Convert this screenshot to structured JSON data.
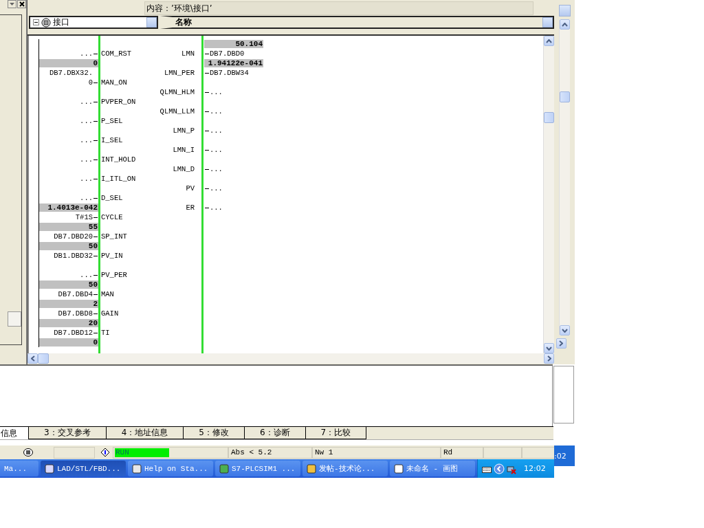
{
  "header": {
    "content_label": "内容：’环境\\接口’",
    "tree_node": "接口",
    "column_header": "名称"
  },
  "block": {
    "inputs": [
      {
        "name": "COM_RST",
        "address": "..."
      },
      {
        "name": "MAN_ON",
        "value": "0",
        "address_lines": [
          "DB7.DBX32."
        ],
        "address": "0"
      },
      {
        "name": "PVPER_ON",
        "address": "..."
      },
      {
        "name": "P_SEL",
        "address": "..."
      },
      {
        "name": "I_SEL",
        "address": "..."
      },
      {
        "name": "INT_HOLD",
        "address": "..."
      },
      {
        "name": "I_ITL_ON",
        "address": "..."
      },
      {
        "name": "D_SEL",
        "address": "..."
      },
      {
        "name": "CYCLE",
        "value": "1.4013e-042",
        "address": "T#1S"
      },
      {
        "name": "SP_INT",
        "value": "55",
        "address": "DB7.DBD20"
      },
      {
        "name": "PV_IN",
        "value": "50",
        "address": "DB1.DBD32"
      },
      {
        "name": "PV_PER",
        "address": "..."
      },
      {
        "name": "MAN",
        "value": "50",
        "address": "DB7.DBD4"
      },
      {
        "name": "GAIN",
        "value": "2",
        "address": "DB7.DBD8"
      },
      {
        "name": "TI",
        "value": "20",
        "address": "DB7.DBD12"
      },
      {
        "value": "0"
      }
    ],
    "outputs": [
      {
        "name": "LMN",
        "value": "50.104",
        "address": "DB7.DBD0"
      },
      {
        "name": "LMN_PER",
        "value": "1.94122e-041",
        "address": "DB7.DBW34"
      },
      {
        "name": "QLMN_HLM",
        "address": "..."
      },
      {
        "name": "QLMN_LLM",
        "address": "..."
      },
      {
        "name": "LMN_P",
        "address": "..."
      },
      {
        "name": "LMN_I",
        "address": "..."
      },
      {
        "name": "LMN_D",
        "address": "..."
      },
      {
        "name": "PV",
        "address": "..."
      },
      {
        "name": "ER",
        "address": "..."
      }
    ]
  },
  "tabs": [
    {
      "label": "信息",
      "selected": true
    },
    {
      "label": "3：交叉参考",
      "selected": false
    },
    {
      "label": "4：地址信息",
      "selected": false
    },
    {
      "label": "5：修改",
      "selected": false
    },
    {
      "label": "6：诊断",
      "selected": false
    },
    {
      "label": "7：比较",
      "selected": false
    }
  ],
  "status_bar": {
    "mode": "RUN",
    "address": "Abs < 5.2",
    "network": "Nw 1",
    "access": "Rd",
    "clock_fragment": ":02"
  },
  "taskbar": {
    "items": [
      {
        "label": "Ma...",
        "selected": false
      },
      {
        "label": "LAD/STL/FBD...",
        "selected": true
      },
      {
        "label": "Help on Sta...",
        "selected": false
      },
      {
        "label": "S7-PLCSIM1 ...",
        "selected": false
      },
      {
        "label": "发帖-技术论...",
        "selected": false
      },
      {
        "label": "未命名 - 画图",
        "selected": false
      }
    ],
    "clock": "12:02"
  }
}
